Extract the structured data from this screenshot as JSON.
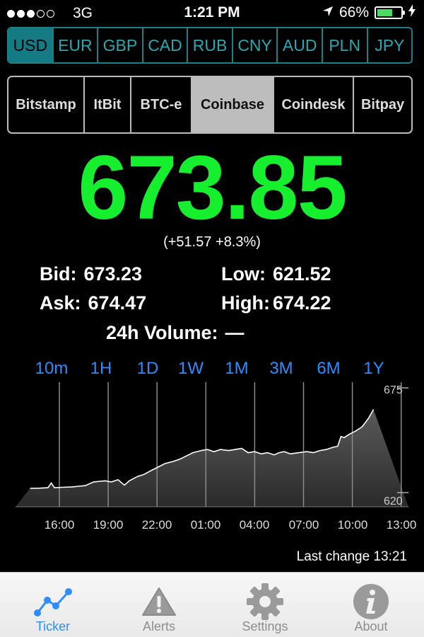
{
  "status_bar": {
    "carrier": "3G",
    "time": "1:21 PM",
    "battery": "66%",
    "signal_dots": 5,
    "signal_filled": 3
  },
  "currencies": [
    "USD",
    "EUR",
    "GBP",
    "CAD",
    "RUB",
    "CNY",
    "AUD",
    "PLN",
    "JPY"
  ],
  "selected_currency": "USD",
  "exchanges": [
    "Bitstamp",
    "ItBit",
    "BTC-e",
    "Coinbase",
    "Coindesk",
    "Bitpay"
  ],
  "selected_exchange": "Coinbase",
  "ticker": {
    "price": "673.85",
    "change": "(+51.57 +8.3%)",
    "bid_label": "Bid:",
    "bid": "673.23",
    "ask_label": "Ask:",
    "ask": "674.47",
    "low_label": "Low:",
    "low": "621.52",
    "high_label": "High:",
    "high": "674.22",
    "volume_label": "24h Volume:",
    "volume": "—"
  },
  "periods": [
    "10m",
    "1H",
    "1D",
    "1W",
    "1M",
    "3M",
    "6M",
    "1Y"
  ],
  "selected_period": "1D",
  "chart_data": {
    "type": "area",
    "x_ticks": [
      "16:00",
      "19:00",
      "22:00",
      "01:00",
      "04:00",
      "07:00",
      "10:00",
      "13:00"
    ],
    "y_ticks": [
      "675",
      "620"
    ],
    "ylim": [
      620,
      675
    ],
    "grid": "vertical",
    "x": [
      0,
      0.6,
      1.1,
      1.3,
      1.5,
      2.0,
      2.6,
      3.0,
      3.4,
      3.9,
      4.3,
      4.6,
      5.0,
      5.4,
      5.8,
      6.1,
      6.6,
      7.0,
      7.5,
      7.9,
      8.3,
      8.8,
      9.2,
      9.6,
      10.0,
      10.5,
      10.9,
      11.3,
      11.7,
      12.2,
      12.6,
      13.0,
      13.4,
      13.8,
      14.2,
      14.6,
      15.0,
      15.3,
      15.6,
      16.0,
      16.5,
      17.0,
      17.4,
      17.8,
      18.2,
      18.6,
      18.9,
      19.1,
      19.3,
      19.6,
      20.0,
      20.4,
      20.8,
      21.1
    ],
    "values": [
      628.5,
      628.6,
      628.8,
      631.0,
      628.8,
      629.0,
      629.2,
      629.5,
      629.8,
      631.5,
      631.8,
      632.0,
      631.5,
      632.5,
      630.0,
      632.0,
      634.0,
      635.0,
      637.0,
      638.5,
      640.0,
      641.0,
      642.0,
      643.5,
      645.0,
      646.0,
      646.5,
      645.5,
      646.5,
      646.0,
      646.5,
      647.0,
      645.0,
      645.5,
      644.5,
      645.0,
      644.0,
      645.0,
      645.5,
      644.5,
      645.0,
      645.5,
      645.0,
      646.0,
      646.5,
      647.5,
      648.0,
      652.5,
      652.0,
      653.5,
      655.0,
      657.0,
      661.0,
      665.0
    ]
  },
  "last_change": "Last change 13:21",
  "tabs": [
    {
      "label": "Ticker",
      "icon": "ticker-chart-icon"
    },
    {
      "label": "Alerts",
      "icon": "alert-triangle-icon"
    },
    {
      "label": "Settings",
      "icon": "gear-icon"
    },
    {
      "label": "About",
      "icon": "info-icon"
    }
  ],
  "colors": {
    "price": "#16ef2e",
    "accent": "#2f8cff",
    "currency": "#2aa7b1"
  }
}
